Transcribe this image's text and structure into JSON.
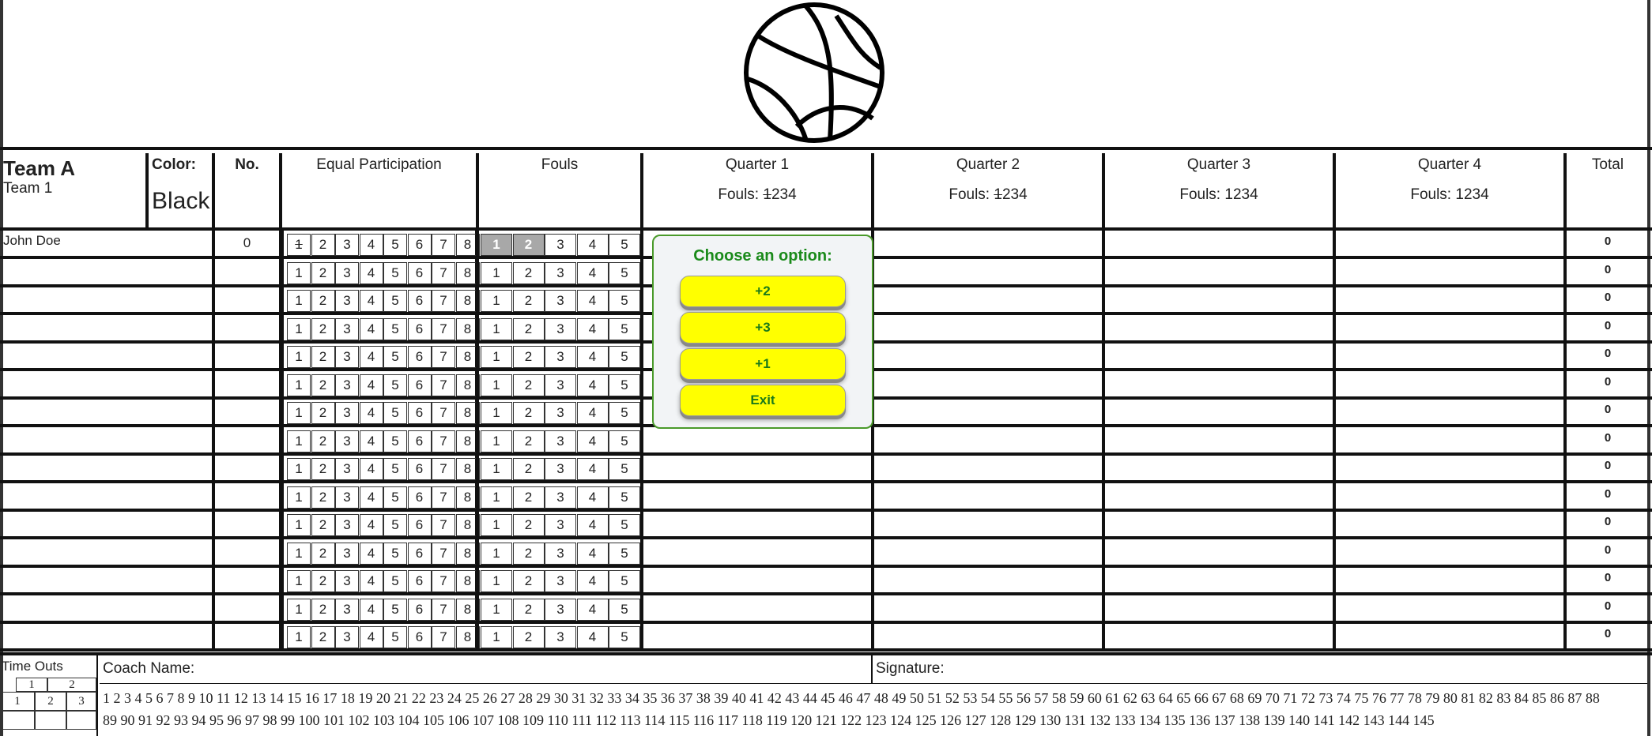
{
  "team": {
    "name": "Team A",
    "subtitle": "Team 1",
    "color_label": "Color:",
    "color_value": "Black"
  },
  "headers": {
    "no": "No.",
    "equal_participation": "Equal Participation",
    "fouls": "Fouls",
    "quarters": [
      {
        "label": "Quarter 1",
        "fouls_text": "Fouls: ",
        "fouls_nums": "1234",
        "struck": "1"
      },
      {
        "label": "Quarter 2",
        "fouls_text": "Fouls: ",
        "fouls_nums": "1234",
        "struck": "1"
      },
      {
        "label": "Quarter 3",
        "fouls_text": "Fouls: ",
        "fouls_nums": "1234",
        "struck": ""
      },
      {
        "label": "Quarter 4",
        "fouls_text": "Fouls: ",
        "fouls_nums": "1234",
        "struck": ""
      }
    ],
    "total": "Total"
  },
  "ep_numbers": [
    "1",
    "2",
    "3",
    "4",
    "5",
    "6",
    "7",
    "8"
  ],
  "foul_numbers": [
    "1",
    "2",
    "3",
    "4",
    "5"
  ],
  "players": [
    {
      "name": "John Doe",
      "number": "0",
      "total": "0",
      "ep_struck": [
        "1"
      ],
      "fouls_active": [
        "1",
        "2"
      ]
    },
    {
      "name": "",
      "number": "",
      "total": "0",
      "ep_struck": [],
      "fouls_active": []
    },
    {
      "name": "",
      "number": "",
      "total": "0",
      "ep_struck": [],
      "fouls_active": []
    },
    {
      "name": "",
      "number": "",
      "total": "0",
      "ep_struck": [],
      "fouls_active": []
    },
    {
      "name": "",
      "number": "",
      "total": "0",
      "ep_struck": [],
      "fouls_active": []
    },
    {
      "name": "",
      "number": "",
      "total": "0",
      "ep_struck": [],
      "fouls_active": []
    },
    {
      "name": "",
      "number": "",
      "total": "0",
      "ep_struck": [],
      "fouls_active": []
    },
    {
      "name": "",
      "number": "",
      "total": "0",
      "ep_struck": [],
      "fouls_active": []
    },
    {
      "name": "",
      "number": "",
      "total": "0",
      "ep_struck": [],
      "fouls_active": []
    },
    {
      "name": "",
      "number": "",
      "total": "0",
      "ep_struck": [],
      "fouls_active": []
    },
    {
      "name": "",
      "number": "",
      "total": "0",
      "ep_struck": [],
      "fouls_active": []
    },
    {
      "name": "",
      "number": "",
      "total": "0",
      "ep_struck": [],
      "fouls_active": []
    },
    {
      "name": "",
      "number": "",
      "total": "0",
      "ep_struck": [],
      "fouls_active": []
    },
    {
      "name": "",
      "number": "",
      "total": "0",
      "ep_struck": [],
      "fouls_active": []
    },
    {
      "name": "",
      "number": "",
      "total": "0",
      "ep_struck": [],
      "fouls_active": []
    }
  ],
  "popup": {
    "title": "Choose an option:",
    "options": [
      "+2",
      "+3",
      "+1",
      "Exit"
    ]
  },
  "footer": {
    "timeouts_label": "Time Outs",
    "timeout_halves": [
      "1",
      "2"
    ],
    "timeout_slots": [
      "1",
      "2",
      "3"
    ],
    "coach_label": "Coach Name:",
    "signature_label": "Signature:",
    "running_score_line1": "1 2 3 4 5 6 7 8 9 10 11 12 13 14 15 16 17 18 19 20 21 22 23 24 25 26 27 28 29 30 31 32 33 34 35 36 37 38 39 40 41 42 43 44 45 46 47 48 49 50 51 52 53 54 55 56 57 58 59 60 61 62 63 64 65 66 67 68 69 70 71 72 73 74 75 76 77 78 79 80 81 82 83 84 85 86 87 88",
    "running_score_line2": "89 90 91 92 93 94 95 96 97 98 99 100 101 102 103 104 105 106 107 108 109 110 111 112 113 114 115 116 117 118 119 120 121 122 123 124 125 126 127 128 129 130 131 132 133 134 135 136 137 138 139 140 141 142 143 144 145"
  },
  "colors": {
    "popup_border": "#4a9a2a",
    "popup_text": "#1a8a1a",
    "button_fill": "#ffff00",
    "active_foul": "#a8a8a8"
  }
}
